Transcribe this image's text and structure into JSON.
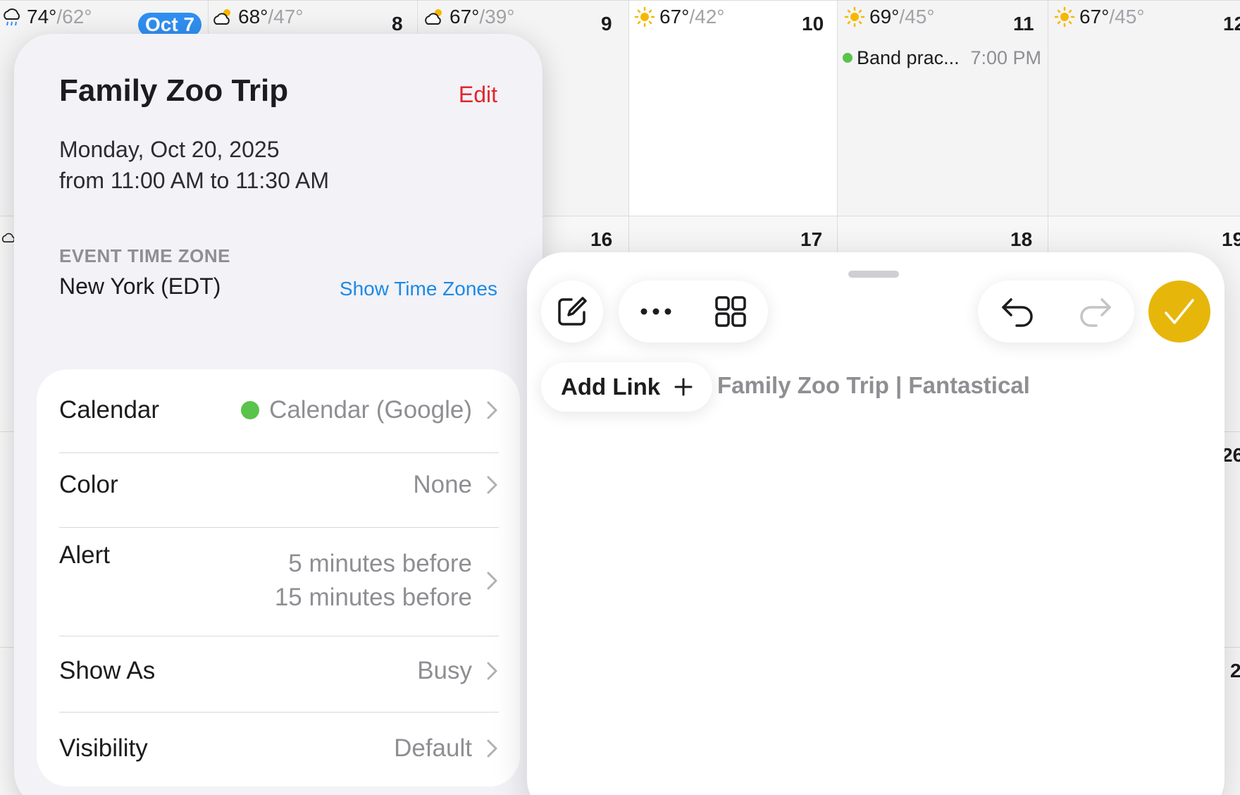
{
  "calendar": {
    "week1": [
      {
        "hi": "74°",
        "lo": "/62°",
        "icon": "rain-icon",
        "day": "Oct 7",
        "today": true
      },
      {
        "hi": "68°",
        "lo": "/47°",
        "icon": "partly-cloudy-icon",
        "day": "8"
      },
      {
        "hi": "67°",
        "lo": "/39°",
        "icon": "partly-cloudy-icon",
        "day": "9"
      },
      {
        "hi": "67°",
        "lo": "/42°",
        "icon": "sun-icon",
        "day": "10"
      },
      {
        "hi": "69°",
        "lo": "/45°",
        "icon": "sun-icon",
        "day": "11"
      },
      {
        "hi": "67°",
        "lo": "/45°",
        "icon": "sun-icon",
        "day": "12"
      }
    ],
    "week2_days": [
      "16",
      "17",
      "18",
      "19"
    ],
    "week3_day": "26",
    "week4_day": "2",
    "event": {
      "title": "Band prac...",
      "time": "7:00 PM",
      "color": "#5ac34b"
    }
  },
  "event_detail": {
    "title": "Family Zoo Trip",
    "edit_label": "Edit",
    "date_line": "Monday, Oct 20, 2025",
    "time_line": "from 11:00 AM to 11:30 AM",
    "tz_label": "EVENT TIME ZONE",
    "tz_value": "New York (EDT)",
    "tz_link": "Show Time Zones",
    "rows": {
      "calendar": {
        "label": "Calendar",
        "value": "Calendar (Google)",
        "dot_color": "#5ac34b"
      },
      "color": {
        "label": "Color",
        "value": "None"
      },
      "alert": {
        "label": "Alert",
        "value1": "5 minutes before",
        "value2": "15 minutes before"
      },
      "show_as": {
        "label": "Show As",
        "value": "Busy"
      },
      "visibility": {
        "label": "Visibility",
        "value": "Default"
      }
    }
  },
  "sheet": {
    "add_link_label": "Add Link",
    "link_title": "Family Zoo Trip | Fantastical",
    "confirm_color": "#e6b70a",
    "icons": [
      "compose-icon",
      "more-icon",
      "grid-icon",
      "undo-icon",
      "redo-icon",
      "checkmark-icon"
    ]
  }
}
